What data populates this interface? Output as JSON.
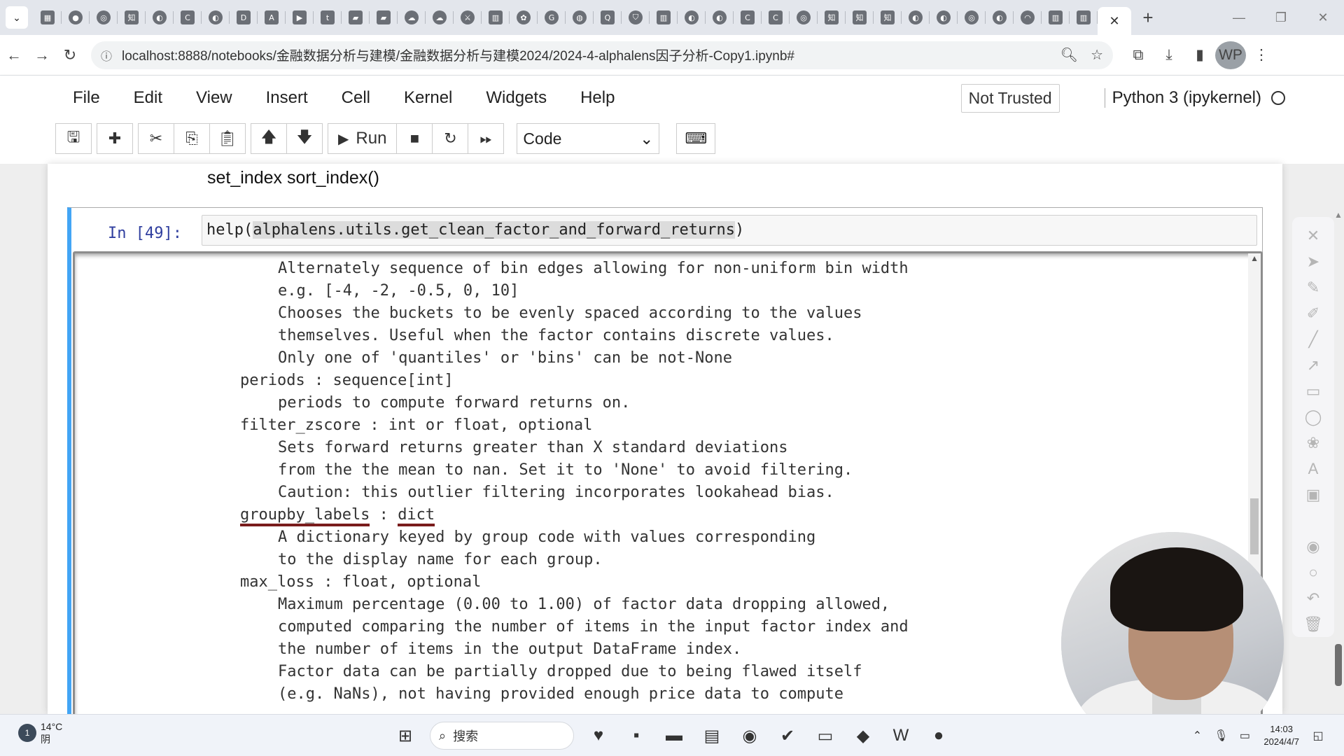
{
  "browser": {
    "tabs_favicons": [
      "calendar-icon",
      "chat-icon",
      "circle-icon",
      "zhihu-icon",
      "github-icon",
      "c-icon",
      "github-icon",
      "d-icon",
      "font-icon",
      "video-icon",
      "tds-icon",
      "bookmark-icon",
      "bookmark-icon",
      "cloud-icon",
      "cloud-icon",
      "fox-icon",
      "book-icon",
      "gear-icon",
      "g-icon",
      "globe-icon",
      "q-icon",
      "shield-icon",
      "book-icon",
      "github-icon",
      "github-icon",
      "c-icon",
      "c-icon",
      "circle-icon",
      "zhihu-icon",
      "zhihu-icon",
      "zhihu-icon",
      "github-icon",
      "github-icon",
      "circle-icon",
      "github-icon",
      "loading-icon",
      "book-icon",
      "book-icon"
    ],
    "active_tab_close": "✕",
    "new_tab": "+",
    "url": "localhost:8888/notebooks/金融数据分析与建模/金融数据分析与建模2024/2024-4-alphalens因子分析-Copy1.ipynb#",
    "profile_initials": "WP"
  },
  "jupyter": {
    "menu": [
      "File",
      "Edit",
      "View",
      "Insert",
      "Cell",
      "Kernel",
      "Widgets",
      "Help"
    ],
    "trust_status": "Not Trusted",
    "kernel_name": "Python 3 (ipykernel)",
    "run_label": "Run",
    "cell_type": "Code"
  },
  "notebook": {
    "markdown_text": "set_index sort_index()",
    "cell_prompt": "In  [49]:",
    "code": {
      "prefix": "help(",
      "arg": "alphalens.utils.get_clean_factor_and_forward_returns",
      "suffix": ")"
    },
    "output_lines": [
      {
        "indent": 2,
        "text": "Alternately sequence of bin edges allowing for non-uniform bin width"
      },
      {
        "indent": 2,
        "text": "e.g. [-4, -2, -0.5, 0, 10]"
      },
      {
        "indent": 2,
        "text": "Chooses the buckets to be evenly spaced according to the values"
      },
      {
        "indent": 2,
        "text": "themselves. Useful when the factor contains discrete values."
      },
      {
        "indent": 2,
        "text": "Only one of 'quantiles' or 'bins' can be not-None"
      },
      {
        "indent": 1,
        "text": "periods : sequence[int]"
      },
      {
        "indent": 2,
        "text": "periods to compute forward returns on."
      },
      {
        "indent": 1,
        "text": "filter_zscore : int or float, optional"
      },
      {
        "indent": 2,
        "text": "Sets forward returns greater than X standard deviations"
      },
      {
        "indent": 2,
        "text": "from the the mean to nan. Set it to 'None' to avoid filtering."
      },
      {
        "indent": 2,
        "text": "Caution: this outlier filtering incorporates lookahead bias."
      },
      {
        "indent": 1,
        "text": "groupby_labels : dict",
        "underline": true
      },
      {
        "indent": 2,
        "text": "A dictionary keyed by group code with values corresponding"
      },
      {
        "indent": 2,
        "text": "to the display name for each group."
      },
      {
        "indent": 1,
        "text": "max_loss : float, optional"
      },
      {
        "indent": 2,
        "text": "Maximum percentage (0.00 to 1.00) of factor data dropping allowed,"
      },
      {
        "indent": 2,
        "text": "computed comparing the number of items in the input factor index and"
      },
      {
        "indent": 2,
        "text": "the number of items in the output DataFrame index."
      },
      {
        "indent": 2,
        "text": "Factor data can be partially dropped due to being flawed itself"
      },
      {
        "indent": 2,
        "text": "(e.g. NaNs), not having provided enough price data to compute"
      }
    ]
  },
  "taskbar": {
    "weather_temp": "14°C",
    "weather_desc": "阴",
    "search_placeholder": "搜索",
    "time": "14:03",
    "date": "2024/4/7",
    "notification_count": "1"
  }
}
